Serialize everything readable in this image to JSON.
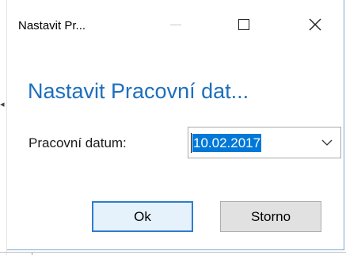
{
  "window": {
    "title": "Nastavit Pr...",
    "minimize_label": "—",
    "maximize_label": "☐",
    "close_label": "✕"
  },
  "dialog": {
    "heading": "Nastavit Pracovní dat...",
    "field_label": "Pracovní datum:",
    "date_value": "10.02.2017"
  },
  "buttons": {
    "ok_label": "Ok",
    "cancel_label": "Storno"
  },
  "icons": {
    "minimize": "minimize-icon",
    "maximize": "maximize-icon",
    "close": "close-icon",
    "dropdown": "chevron-down-icon"
  },
  "colors": {
    "heading": "#1e6fbe",
    "selection": "#0078d7",
    "ok_border": "#2f7dcb",
    "ok_background": "#e5f1fb",
    "cancel_background": "#e1e1e1"
  }
}
